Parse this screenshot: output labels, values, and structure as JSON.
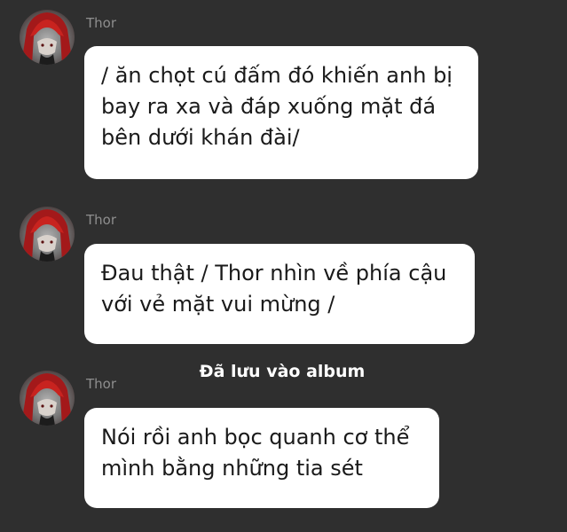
{
  "messages": [
    {
      "sender": "Thor",
      "avatar_icon": "red-haired-character-avatar",
      "text": "/ ăn chọt cú đấm đó khiến anh bị bay ra xa và đáp xuống mặt đá bên dưới khán đài/"
    },
    {
      "sender": "Thor",
      "avatar_icon": "red-haired-character-avatar",
      "text": "Đau thật / Thor nhìn về phía cậu với vẻ mặt vui mừng /"
    },
    {
      "sender": "Thor",
      "avatar_icon": "red-haired-character-avatar",
      "text": "Nói rồi anh bọc quanh cơ thể mình bằng những tia sét"
    }
  ],
  "toast": {
    "text": "Đã lưu vào album"
  },
  "colors": {
    "background": "#2f2f2f",
    "bubble": "#ffffff",
    "sender_name": "#8e8e8e",
    "toast_text": "#ffffff"
  }
}
